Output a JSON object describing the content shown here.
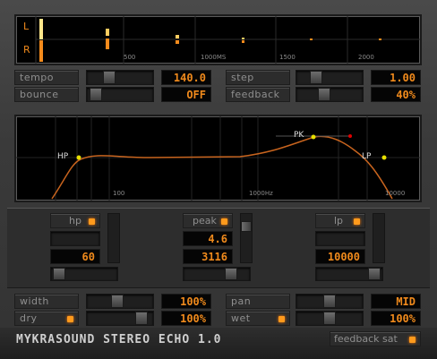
{
  "delay_display": {
    "channel_left": "L",
    "channel_right": "R",
    "ticks": [
      "500",
      "1000MS",
      "1500",
      "2000"
    ]
  },
  "delay_controls": {
    "tempo_label": "tempo",
    "tempo_value": "140.0",
    "step_label": "step",
    "step_value": "1.00",
    "bounce_label": "bounce",
    "bounce_value": "OFF",
    "feedback_label": "feedback",
    "feedback_value": "40%",
    "tempo_level": 0.3,
    "step_level": 0.25,
    "bounce_level": 0.05,
    "feedback_level": 0.4
  },
  "eq_display": {
    "hp_label": "HP",
    "pk_label": "PK",
    "lp_label": "LP",
    "ticks": [
      "100",
      "1000Hz",
      "10000"
    ],
    "curve_color": "#c8641e",
    "point_color": "#e8e000",
    "handle_color": "#e00000"
  },
  "filters": {
    "hp": {
      "label": "hp",
      "value": "60"
    },
    "peak": {
      "label": "peak",
      "gain": "4.6",
      "freq": "3116"
    },
    "lp": {
      "label": "lp",
      "value": "10000"
    }
  },
  "mix": {
    "width_label": "width",
    "width_value": "100%",
    "pan_label": "pan",
    "pan_value": "MID",
    "dry_label": "dry",
    "dry_value": "100%",
    "wet_label": "wet",
    "wet_value": "100%",
    "width_level": 0.45,
    "pan_level": 0.5,
    "dry_level": 0.9,
    "wet_level": 0.5
  },
  "footer": {
    "title": "MYKRASOUND STEREO ECHO 1.0",
    "feedback_sat_label": "feedback sat"
  },
  "colors": {
    "accent": "#f08a1c",
    "background": "#3a3a3a"
  }
}
